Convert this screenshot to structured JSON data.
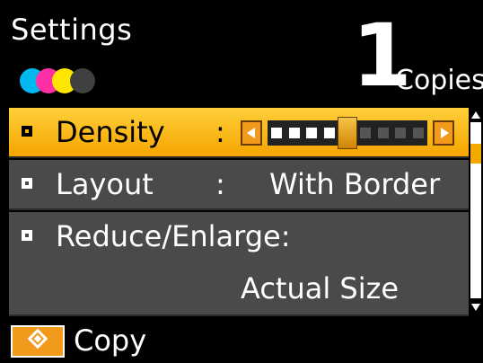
{
  "header": {
    "title": "Settings",
    "copies_count": "1",
    "copies_label": "Copies",
    "ink_colors": [
      "#00b7ef",
      "#ff2fa6",
      "#ffe600",
      "#404040"
    ]
  },
  "menu": {
    "items": [
      {
        "label": "Density",
        "value": "",
        "selected": true
      },
      {
        "label": "Layout",
        "value": "With Border",
        "selected": false
      },
      {
        "label": "Reduce/Enlarge:",
        "value": "Actual Size",
        "selected": false
      }
    ],
    "density": {
      "segments": 9,
      "level": 5,
      "left_icon": "left-arrow-icon",
      "right_icon": "right-arrow-icon"
    }
  },
  "scrollbar": {
    "up_icon": "scroll-up-icon",
    "down_icon": "scroll-down-icon"
  },
  "footer": {
    "icon": "start-diamond-icon",
    "label": "Copy"
  },
  "colors": {
    "accent": "#f5a900",
    "row_bg": "#4a4a4a",
    "background": "#000000"
  }
}
